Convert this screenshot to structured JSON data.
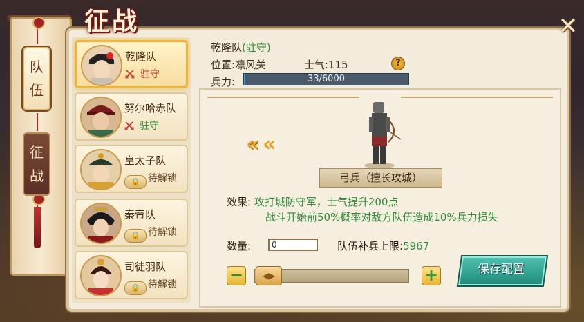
{
  "title": "征战",
  "close_label": "✕",
  "side_tabs": [
    {
      "label": "队\n伍",
      "active": true
    },
    {
      "label": "征\n战",
      "active": false
    }
  ],
  "teams": [
    {
      "name": "乾隆队",
      "status": "驻守",
      "status_type": "guard"
    },
    {
      "name": "努尔哈赤队",
      "status": "驻守",
      "status_type": "guard"
    },
    {
      "name": "皇太子队",
      "status": "待解锁",
      "status_type": "locked"
    },
    {
      "name": "秦帝队",
      "status": "待解锁",
      "status_type": "locked"
    },
    {
      "name": "司徒羽队",
      "status": "待解锁",
      "status_type": "locked"
    }
  ],
  "detail": {
    "team_name": "乾隆队",
    "team_state": "(驻守)",
    "location_label": "位置:",
    "location": "凛风关",
    "morale_label": "士气:",
    "morale": "115",
    "troops_label": "兵力:",
    "troops_text": "33/6000",
    "troops_current": 33,
    "troops_max": 6000,
    "help_icon": "?"
  },
  "unit": {
    "arrow_icon": "«",
    "label": "弓兵（擅长攻城）"
  },
  "effect": {
    "label": "效果:",
    "line1": "攻打城防守军，士气提升200点",
    "line2": "战斗开始前50%概率对敌方队伍造成10%兵力损失"
  },
  "quantity": {
    "label": "数量:",
    "value": "0",
    "limit_label": "队伍补兵上限:",
    "limit_value": "5967",
    "minus": "−",
    "plus": "+",
    "slider_handle": "◀▶"
  },
  "save_button": "保存配置"
}
